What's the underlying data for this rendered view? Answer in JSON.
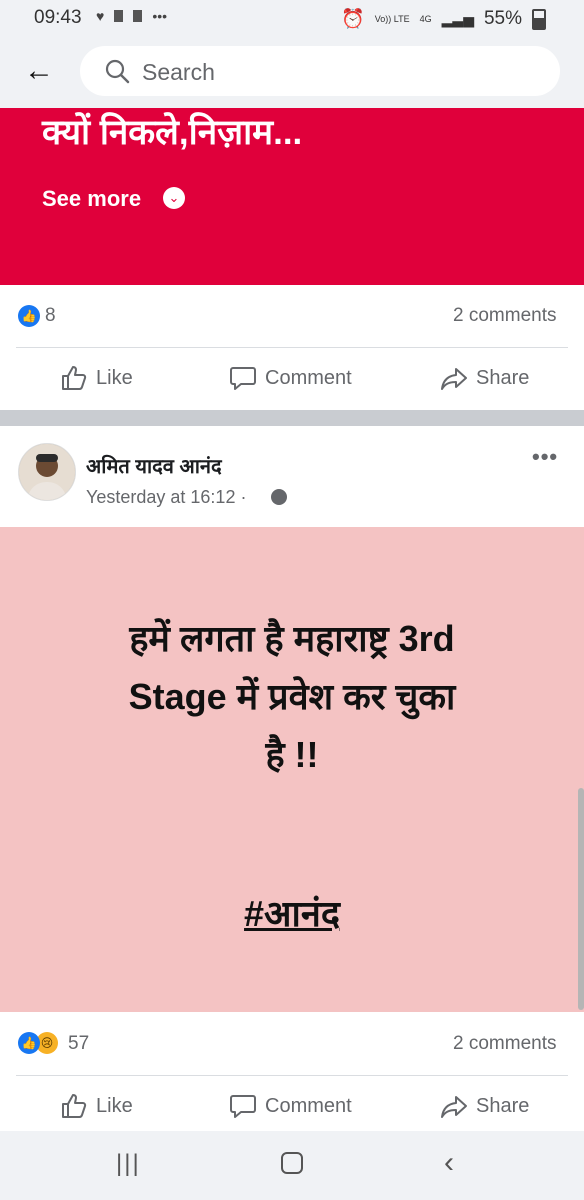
{
  "status_bar": {
    "time": "09:43",
    "signal_label": "Vo)) LTE",
    "network": "4G",
    "battery": "55%"
  },
  "search": {
    "placeholder": "Search"
  },
  "post1": {
    "banner_text": "क्यों निकले,निज़ाम...",
    "see_more": "See more",
    "reaction_count": "8",
    "comments": "2 comments"
  },
  "actions": {
    "like": "Like",
    "comment": "Comment",
    "share": "Share"
  },
  "post2": {
    "author": "अमित यादव आनंद",
    "time": "Yesterday at 16:12 ·",
    "text_line1": "हमें लगता है महाराष्ट्र 3rd",
    "text_line2": "Stage में प्रवेश कर चुका",
    "text_line3": "है !!",
    "hashtag": "#आनंद",
    "reaction_count": "57",
    "comments": "2 comments"
  },
  "colors": {
    "banner_red": "#e0003b",
    "post_pink": "#f4c3c3",
    "facebook_blue": "#1877f2"
  }
}
